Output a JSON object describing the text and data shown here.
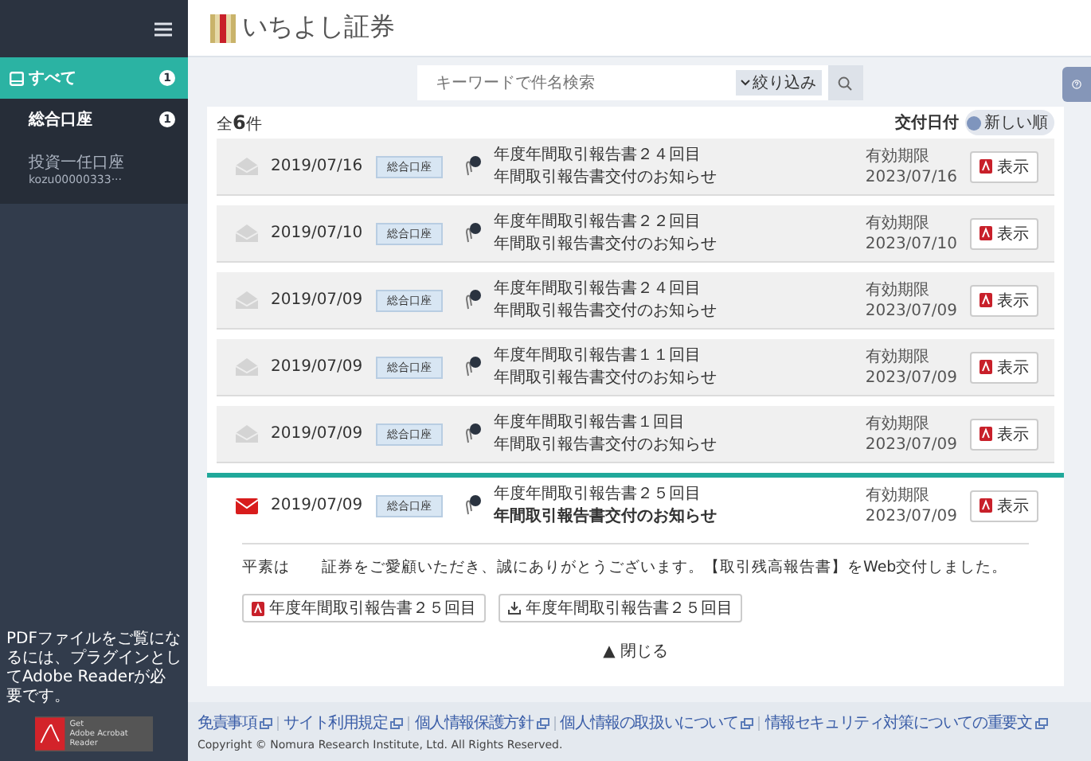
{
  "sidebar": {
    "items": [
      {
        "label": "すべて",
        "badge": "1",
        "selected": true,
        "kind": "all"
      },
      {
        "label": "総合口座",
        "badge": "1",
        "selected": false,
        "kind": "account"
      },
      {
        "label": "投資一任口座",
        "sub": "kozu00000333···",
        "selected": false,
        "kind": "discretionary"
      }
    ],
    "pdf_note": "PDFファイルをご覧になるには、プラグインとしてAdobe Readerが必要です。",
    "adobe_badge": {
      "small": "Get",
      "label": "Adobe Acrobat Reader"
    }
  },
  "header": {
    "logo_text": "いちよし証券"
  },
  "search": {
    "placeholder": "キーワードで件名検索",
    "filter_label": "絞り込み"
  },
  "count": {
    "prefix": "全",
    "number": "6",
    "suffix": "件"
  },
  "sort": {
    "label": "交付日付",
    "toggle_label": "新しい順",
    "on": true
  },
  "messages": [
    {
      "date": "2019/07/16",
      "account": "総合口座",
      "title": "年度年間取引報告書２４回目",
      "subject": "年間取引報告書交付のお知らせ",
      "expiry_label": "有効期限",
      "expiry": "2023/07/16",
      "view": "表示",
      "unread": false,
      "expanded": false
    },
    {
      "date": "2019/07/10",
      "account": "総合口座",
      "title": "年度年間取引報告書２２回目",
      "subject": "年間取引報告書交付のお知らせ",
      "expiry_label": "有効期限",
      "expiry": "2023/07/10",
      "view": "表示",
      "unread": false,
      "expanded": false
    },
    {
      "date": "2019/07/09",
      "account": "総合口座",
      "title": "年度年間取引報告書２４回目",
      "subject": "年間取引報告書交付のお知らせ",
      "expiry_label": "有効期限",
      "expiry": "2023/07/09",
      "view": "表示",
      "unread": false,
      "expanded": false
    },
    {
      "date": "2019/07/09",
      "account": "総合口座",
      "title": "年度年間取引報告書１１回目",
      "subject": "年間取引報告書交付のお知らせ",
      "expiry_label": "有効期限",
      "expiry": "2023/07/09",
      "view": "表示",
      "unread": false,
      "expanded": false
    },
    {
      "date": "2019/07/09",
      "account": "総合口座",
      "title": "年度年間取引報告書１回目",
      "subject": "年間取引報告書交付のお知らせ",
      "expiry_label": "有効期限",
      "expiry": "2023/07/09",
      "view": "表示",
      "unread": false,
      "expanded": false
    },
    {
      "date": "2019/07/09",
      "account": "総合口座",
      "title": "年度年間取引報告書２５回目",
      "subject": "年間取引報告書交付のお知らせ",
      "expiry_label": "有効期限",
      "expiry": "2023/07/09",
      "view": "表示",
      "unread": true,
      "expanded": true,
      "body": "平素は　　証券をご愛顧いただき、誠にありがとうございます。【取引残高報告書】をWeb交付しました。",
      "attachments": [
        {
          "kind": "pdf",
          "label": "年度年間取引報告書２５回目"
        },
        {
          "kind": "download",
          "label": "年度年間取引報告書２５回目"
        }
      ],
      "collapse": "▲ 閉じる"
    }
  ],
  "footer": {
    "links": [
      "免責事項",
      "サイト利用規定",
      "個人情報保護方針",
      "個人情報の取扱いについて",
      "情報セキュリティ対策についての重要文"
    ],
    "copyright": "Copyright © Nomura Research Institute, Ltd. All Rights Reserved."
  }
}
